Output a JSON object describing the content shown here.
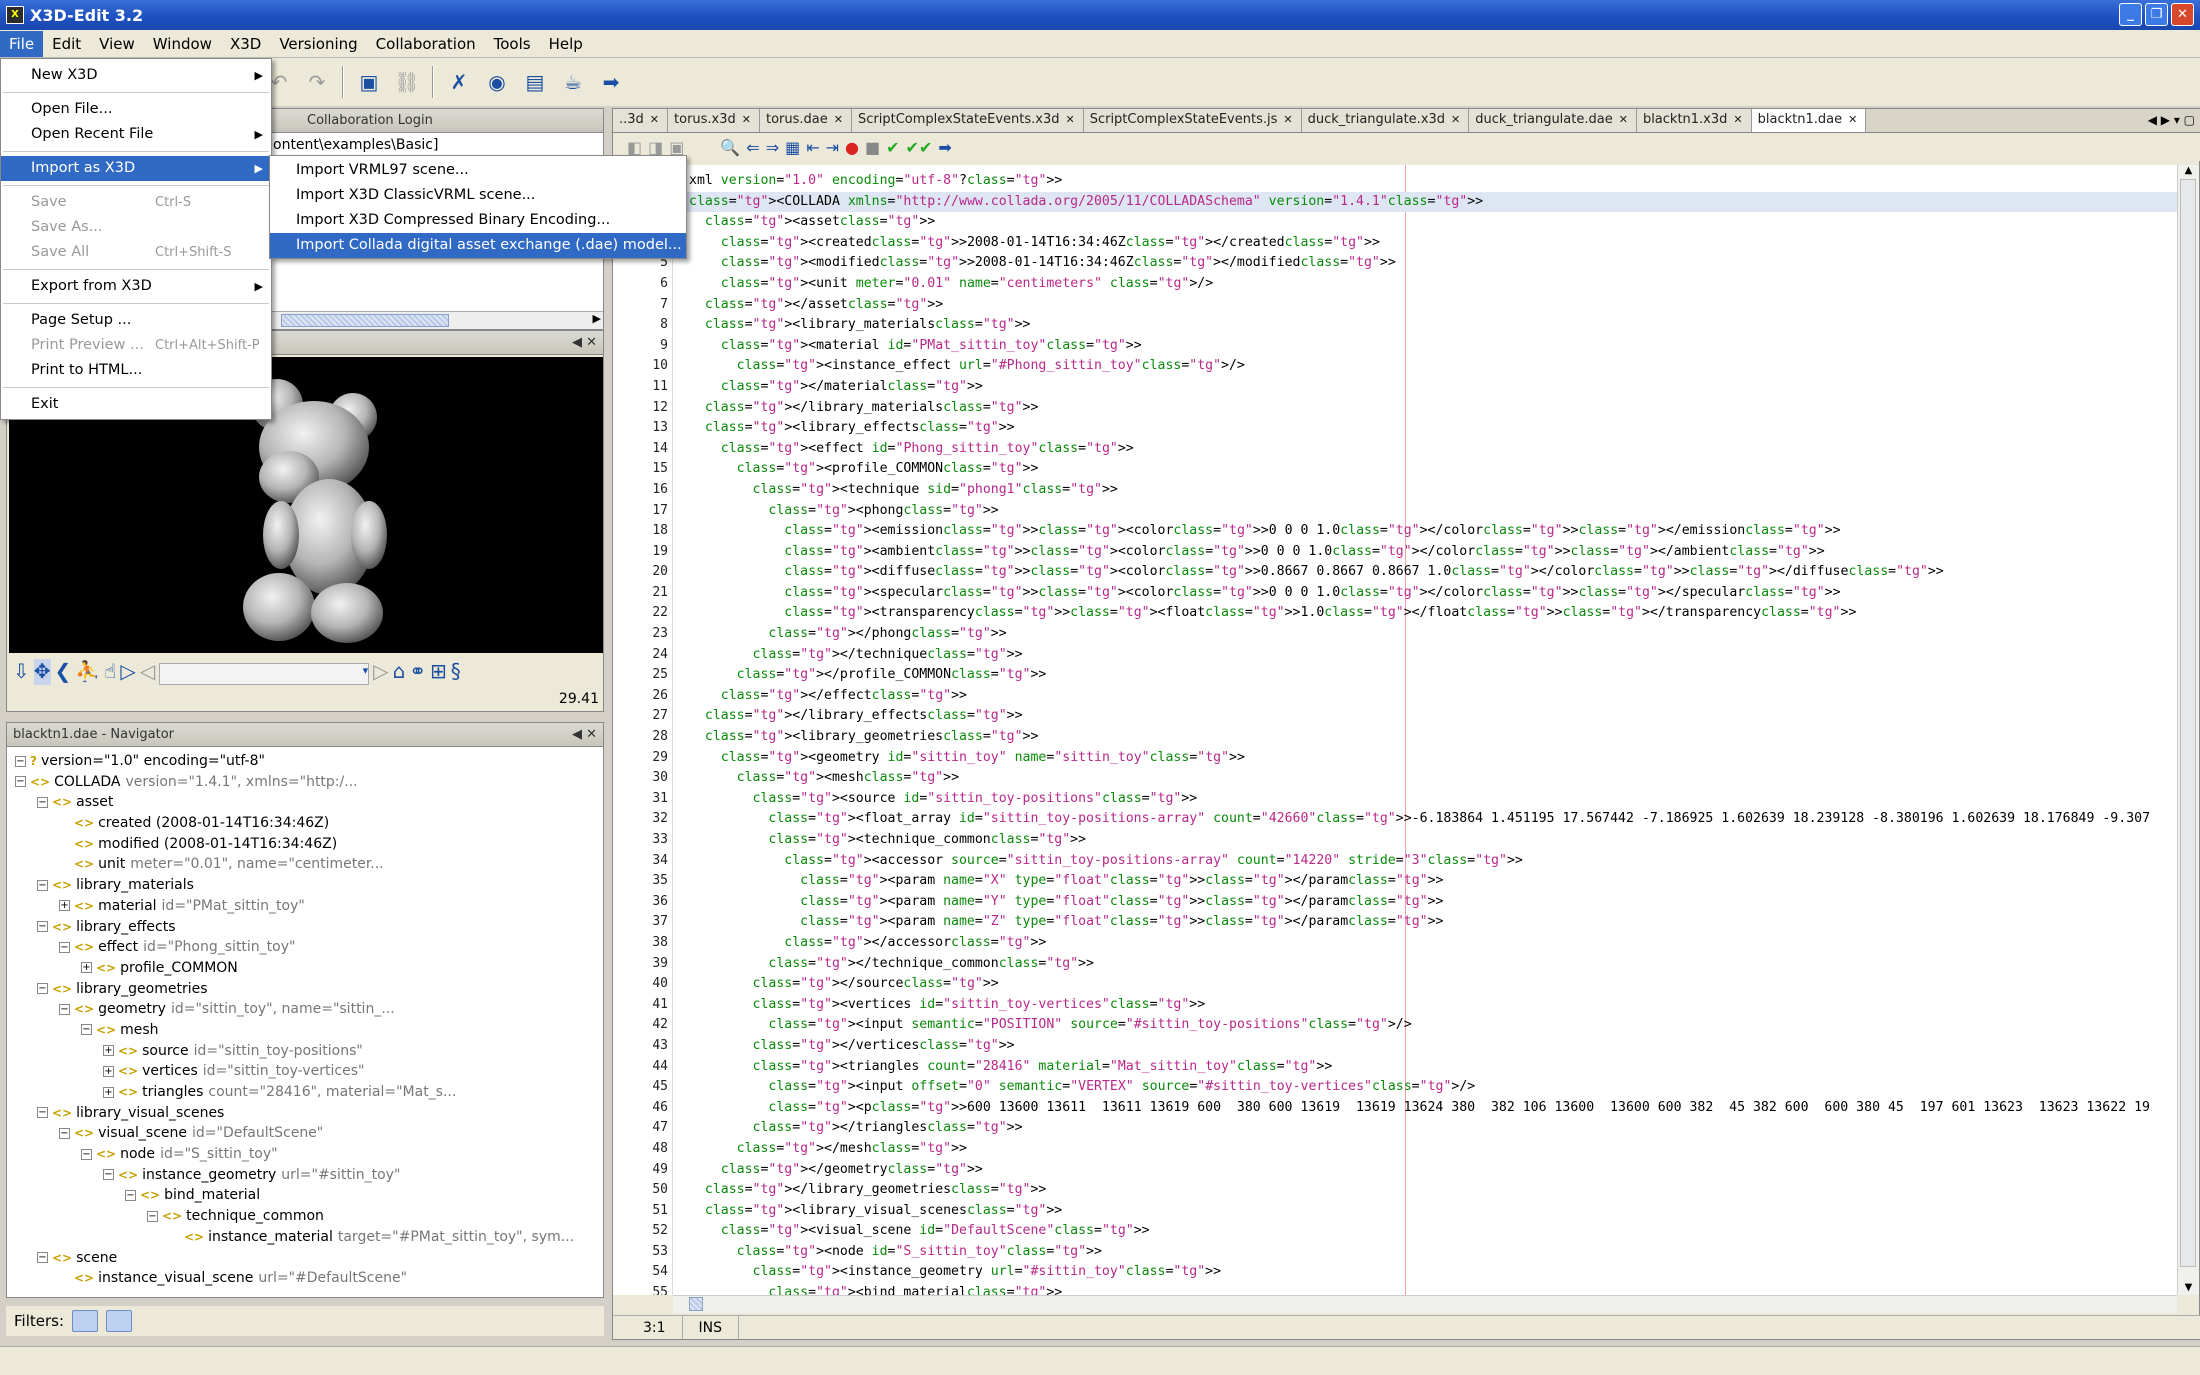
{
  "app": {
    "title": "X3D-Edit 3.2"
  },
  "menubar": [
    "File",
    "Edit",
    "View",
    "Window",
    "X3D",
    "Versioning",
    "Collaboration",
    "Tools",
    "Help"
  ],
  "file_menu": {
    "new_x3d": "New X3D",
    "open_file": "Open File...",
    "open_recent": "Open Recent File",
    "import_as": "Import as X3D",
    "save": "Save",
    "save_sc": "Ctrl-S",
    "save_as": "Save As...",
    "save_all": "Save All",
    "save_all_sc": "Ctrl+Shift-S",
    "export": "Export from X3D",
    "page_setup": "Page Setup ...",
    "print_preview": "Print Preview ...",
    "print_preview_sc": "Ctrl+Alt+Shift-P",
    "print_html": "Print to HTML...",
    "exit": "Exit"
  },
  "import_submenu": [
    "Import VRML97 scene...",
    "Import X3D ClassicVRML scene...",
    "Import X3D Compressed Binary Encoding...",
    "Import Collada digital asset exchange (.dae) model..."
  ],
  "left_top": {
    "tab2": "Collaboration Login",
    "path": "ontent\\examples\\Basic]"
  },
  "viewer": {
    "fps": "29.41"
  },
  "navigator": {
    "title": "blacktn1.dae - Navigator",
    "filters_label": "Filters:"
  },
  "tree": [
    {
      "d": 0,
      "t": "-",
      "el": false,
      "name": "version=\"1.0\" encoding=\"utf-8\"",
      "attr": ""
    },
    {
      "d": 0,
      "t": "-",
      "el": true,
      "name": "COLLADA",
      "attr": "version=\"1.4.1\", xmlns=\"http:/..."
    },
    {
      "d": 1,
      "t": "-",
      "el": true,
      "name": "asset",
      "attr": ""
    },
    {
      "d": 2,
      "t": "",
      "el": true,
      "name": "created (2008-01-14T16:34:46Z)",
      "attr": ""
    },
    {
      "d": 2,
      "t": "",
      "el": true,
      "name": "modified (2008-01-14T16:34:46Z)",
      "attr": ""
    },
    {
      "d": 2,
      "t": "",
      "el": true,
      "name": "unit",
      "attr": "meter=\"0.01\", name=\"centimeter..."
    },
    {
      "d": 1,
      "t": "-",
      "el": true,
      "name": "library_materials",
      "attr": ""
    },
    {
      "d": 2,
      "t": "+",
      "el": true,
      "name": "material",
      "attr": "id=\"PMat_sittin_toy\""
    },
    {
      "d": 1,
      "t": "-",
      "el": true,
      "name": "library_effects",
      "attr": ""
    },
    {
      "d": 2,
      "t": "-",
      "el": true,
      "name": "effect",
      "attr": "id=\"Phong_sittin_toy\""
    },
    {
      "d": 3,
      "t": "+",
      "el": true,
      "name": "profile_COMMON",
      "attr": ""
    },
    {
      "d": 1,
      "t": "-",
      "el": true,
      "name": "library_geometries",
      "attr": ""
    },
    {
      "d": 2,
      "t": "-",
      "el": true,
      "name": "geometry",
      "attr": "id=\"sittin_toy\", name=\"sittin_..."
    },
    {
      "d": 3,
      "t": "-",
      "el": true,
      "name": "mesh",
      "attr": ""
    },
    {
      "d": 4,
      "t": "+",
      "el": true,
      "name": "source",
      "attr": "id=\"sittin_toy-positions\""
    },
    {
      "d": 4,
      "t": "+",
      "el": true,
      "name": "vertices",
      "attr": "id=\"sittin_toy-vertices\""
    },
    {
      "d": 4,
      "t": "+",
      "el": true,
      "name": "triangles",
      "attr": "count=\"28416\", material=\"Mat_s..."
    },
    {
      "d": 1,
      "t": "-",
      "el": true,
      "name": "library_visual_scenes",
      "attr": ""
    },
    {
      "d": 2,
      "t": "-",
      "el": true,
      "name": "visual_scene",
      "attr": "id=\"DefaultScene\""
    },
    {
      "d": 3,
      "t": "-",
      "el": true,
      "name": "node",
      "attr": "id=\"S_sittin_toy\""
    },
    {
      "d": 4,
      "t": "-",
      "el": true,
      "name": "instance_geometry",
      "attr": "url=\"#sittin_toy\""
    },
    {
      "d": 5,
      "t": "-",
      "el": true,
      "name": "bind_material",
      "attr": ""
    },
    {
      "d": 6,
      "t": "-",
      "el": true,
      "name": "technique_common",
      "attr": ""
    },
    {
      "d": 7,
      "t": "",
      "el": true,
      "name": "instance_material",
      "attr": "target=\"#PMat_sittin_toy\", sym..."
    },
    {
      "d": 1,
      "t": "-",
      "el": true,
      "name": "scene",
      "attr": ""
    },
    {
      "d": 2,
      "t": "",
      "el": true,
      "name": "instance_visual_scene",
      "attr": "url=\"#DefaultScene\""
    }
  ],
  "editor_tabs": [
    {
      "label": "..3d",
      "active": false
    },
    {
      "label": "torus.x3d",
      "active": false
    },
    {
      "label": "torus.dae",
      "active": false
    },
    {
      "label": "ScriptComplexStateEvents.x3d",
      "active": false
    },
    {
      "label": "ScriptComplexStateEvents.js",
      "active": false
    },
    {
      "label": "duck_triangulate.x3d",
      "active": false
    },
    {
      "label": "duck_triangulate.dae",
      "active": false
    },
    {
      "label": "blacktn1.x3d",
      "active": false
    },
    {
      "label": "blacktn1.dae",
      "active": true
    }
  ],
  "code_lines": [
    "xml version=\"1.0\" encoding=\"utf-8\"?>",
    "<COLLADA xmlns=\"http://www.collada.org/2005/11/COLLADASchema\" version=\"1.4.1\">",
    "  <asset>",
    "    <created>2008-01-14T16:34:46Z</created>",
    "    <modified>2008-01-14T16:34:46Z</modified>",
    "    <unit meter=\"0.01\" name=\"centimeters\" />",
    "  </asset>",
    "  <library_materials>",
    "    <material id=\"PMat_sittin_toy\">",
    "      <instance_effect url=\"#Phong_sittin_toy\"/>",
    "    </material>",
    "  </library_materials>",
    "  <library_effects>",
    "    <effect id=\"Phong_sittin_toy\">",
    "      <profile_COMMON>",
    "        <technique sid=\"phong1\">",
    "          <phong>",
    "            <emission><color>0 0 0 1.0</color></emission>",
    "            <ambient><color>0 0 0 1.0</color></ambient>",
    "            <diffuse><color>0.8667 0.8667 0.8667 1.0</color></diffuse>",
    "            <specular><color>0 0 0 1.0</color></specular>",
    "            <transparency><float>1.0</float></transparency>",
    "          </phong>",
    "        </technique>",
    "      </profile_COMMON>",
    "    </effect>",
    "  </library_effects>",
    "  <library_geometries>",
    "    <geometry id=\"sittin_toy\" name=\"sittin_toy\">",
    "      <mesh>",
    "        <source id=\"sittin_toy-positions\">",
    "          <float_array id=\"sittin_toy-positions-array\" count=\"42660\">-6.183864 1.451195 17.567442 -7.186925 1.602639 18.239128 -8.380196 1.602639 18.176849 -9.307",
    "          <technique_common>",
    "            <accessor source=\"sittin_toy-positions-array\" count=\"14220\" stride=\"3\">",
    "              <param name=\"X\" type=\"float\"></param>",
    "              <param name=\"Y\" type=\"float\"></param>",
    "              <param name=\"Z\" type=\"float\"></param>",
    "            </accessor>",
    "          </technique_common>",
    "        </source>",
    "        <vertices id=\"sittin_toy-vertices\">",
    "          <input semantic=\"POSITION\" source=\"#sittin_toy-positions\"/>",
    "        </vertices>",
    "        <triangles count=\"28416\" material=\"Mat_sittin_toy\">",
    "          <input offset=\"0\" semantic=\"VERTEX\" source=\"#sittin_toy-vertices\"/>",
    "          <p>600 13600 13611  13611 13619 600  380 600 13619  13619 13624 380  382 106 13600  13600 600 382  45 382 600  600 380 45  197 601 13623  13623 13622 19",
    "        </triangles>",
    "      </mesh>",
    "    </geometry>",
    "  </library_geometries>",
    "  <library_visual_scenes>",
    "    <visual_scene id=\"DefaultScene\">",
    "      <node id=\"S_sittin_toy\">",
    "        <instance_geometry url=\"#sittin_toy\">",
    "          <bind_material>"
  ],
  "editor_status": {
    "pos": "3:1",
    "mode": "INS"
  }
}
